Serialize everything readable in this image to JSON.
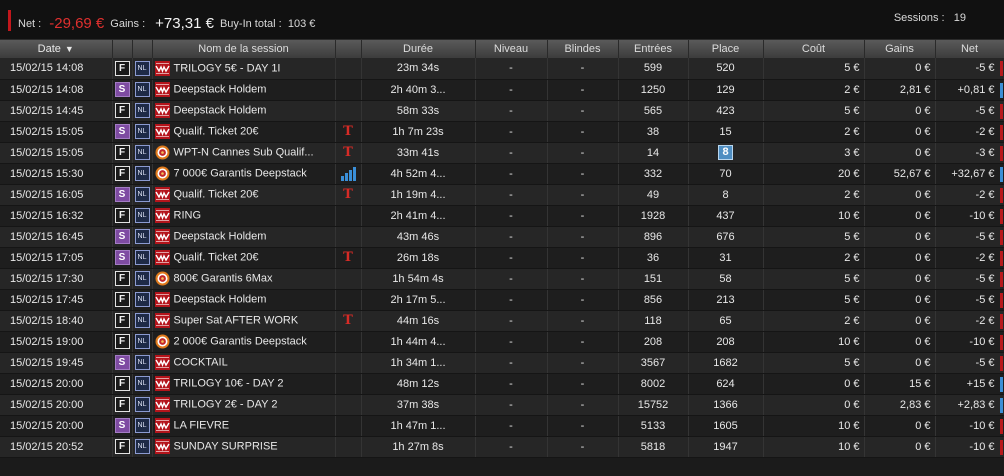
{
  "summary": {
    "net_label": "Net :",
    "net_value": "-29,69 €",
    "gains_label": "Gains :",
    "gains_value": "+73,31 €",
    "buyin_label": "Buy-In total :",
    "buyin_value": "103 €",
    "sessions_label": "Sessions :",
    "sessions_value": "19"
  },
  "columns": {
    "date": "Date",
    "name": "Nom de la session",
    "duree": "Durée",
    "niveau": "Niveau",
    "blindes": "Blindes",
    "entrees": "Entrées",
    "place": "Place",
    "cout": "Coût",
    "gains": "Gains",
    "net": "Net"
  },
  "colors": {
    "negative_flag": "#b8191c",
    "positive_flag": "#3d8fd6",
    "net_negative": "#e0302f"
  },
  "rows": [
    {
      "date": "15/02/15 14:08",
      "type": "F",
      "game": "NL",
      "room": "winamax",
      "name": "TRILOGY 5€ - DAY 1I",
      "marker": "",
      "duree": "23m 34s",
      "niveau": "-",
      "blindes": "-",
      "entrees": "599",
      "place": "520",
      "cout": "5 €",
      "gains": "0 €",
      "net": "-5 €",
      "result": "neg"
    },
    {
      "date": "15/02/15 14:08",
      "type": "S",
      "game": "NL",
      "room": "winamax",
      "name": "Deepstack Holdem",
      "marker": "",
      "duree": "2h 40m 3...",
      "niveau": "-",
      "blindes": "-",
      "entrees": "1250",
      "place": "129",
      "cout": "2 €",
      "gains": "2,81 €",
      "net": "+0,81 €",
      "result": "pos"
    },
    {
      "date": "15/02/15 14:45",
      "type": "F",
      "game": "NL",
      "room": "winamax",
      "name": "Deepstack Holdem",
      "marker": "",
      "duree": "58m 33s",
      "niveau": "-",
      "blindes": "-",
      "entrees": "565",
      "place": "423",
      "cout": "5 €",
      "gains": "0 €",
      "net": "-5 €",
      "result": "neg"
    },
    {
      "date": "15/02/15 15:05",
      "type": "S",
      "game": "NL",
      "room": "winamax",
      "name": "Qualif. Ticket 20€",
      "marker": "ticket",
      "duree": "1h 7m 23s",
      "niveau": "-",
      "blindes": "-",
      "entrees": "38",
      "place": "15",
      "cout": "2 €",
      "gains": "0 €",
      "net": "-2 €",
      "result": "neg"
    },
    {
      "date": "15/02/15 15:05",
      "type": "F",
      "game": "NL",
      "room": "chip",
      "name": "WPT-N Cannes Sub Qualif...",
      "marker": "ticket",
      "duree": "33m 41s",
      "niveau": "-",
      "blindes": "-",
      "entrees": "14",
      "place": "8",
      "place_highlight": true,
      "cout": "3 €",
      "gains": "0 €",
      "net": "-3 €",
      "result": "neg"
    },
    {
      "date": "15/02/15 15:30",
      "type": "F",
      "game": "NL",
      "room": "chip",
      "name": "7 000€ Garantis Deepstack",
      "marker": "chart",
      "duree": "4h 52m 4...",
      "niveau": "-",
      "blindes": "-",
      "entrees": "332",
      "place": "70",
      "cout": "20 €",
      "gains": "52,67 €",
      "net": "+32,67 €",
      "result": "pos"
    },
    {
      "date": "15/02/15 16:05",
      "type": "S",
      "game": "NL",
      "room": "winamax",
      "name": "Qualif. Ticket 20€",
      "marker": "ticket",
      "duree": "1h 19m 4...",
      "niveau": "-",
      "blindes": "-",
      "entrees": "49",
      "place": "8",
      "cout": "2 €",
      "gains": "0 €",
      "net": "-2 €",
      "result": "neg"
    },
    {
      "date": "15/02/15 16:32",
      "type": "F",
      "game": "NL",
      "room": "winamax",
      "name": "RING",
      "marker": "",
      "duree": "2h 41m 4...",
      "niveau": "-",
      "blindes": "-",
      "entrees": "1928",
      "place": "437",
      "cout": "10 €",
      "gains": "0 €",
      "net": "-10 €",
      "result": "neg"
    },
    {
      "date": "15/02/15 16:45",
      "type": "S",
      "game": "NL",
      "room": "winamax",
      "name": "Deepstack Holdem",
      "marker": "",
      "duree": "43m 46s",
      "niveau": "-",
      "blindes": "-",
      "entrees": "896",
      "place": "676",
      "cout": "5 €",
      "gains": "0 €",
      "net": "-5 €",
      "result": "neg"
    },
    {
      "date": "15/02/15 17:05",
      "type": "S",
      "game": "NL",
      "room": "winamax",
      "name": "Qualif. Ticket 20€",
      "marker": "ticket",
      "duree": "26m 18s",
      "niveau": "-",
      "blindes": "-",
      "entrees": "36",
      "place": "31",
      "cout": "2 €",
      "gains": "0 €",
      "net": "-2 €",
      "result": "neg"
    },
    {
      "date": "15/02/15 17:30",
      "type": "F",
      "game": "NL",
      "room": "chip",
      "name": "800€ Garantis 6Max",
      "marker": "",
      "duree": "1h 54m 4s",
      "niveau": "-",
      "blindes": "-",
      "entrees": "151",
      "place": "58",
      "cout": "5 €",
      "gains": "0 €",
      "net": "-5 €",
      "result": "neg"
    },
    {
      "date": "15/02/15 17:45",
      "type": "F",
      "game": "NL",
      "room": "winamax",
      "name": "Deepstack Holdem",
      "marker": "",
      "duree": "2h 17m 5...",
      "niveau": "-",
      "blindes": "-",
      "entrees": "856",
      "place": "213",
      "cout": "5 €",
      "gains": "0 €",
      "net": "-5 €",
      "result": "neg"
    },
    {
      "date": "15/02/15 18:40",
      "type": "F",
      "game": "NL",
      "room": "winamax",
      "name": "Super Sat AFTER WORK",
      "marker": "ticket",
      "duree": "44m 16s",
      "niveau": "-",
      "blindes": "-",
      "entrees": "118",
      "place": "65",
      "cout": "2 €",
      "gains": "0 €",
      "net": "-2 €",
      "result": "neg"
    },
    {
      "date": "15/02/15 19:00",
      "type": "F",
      "game": "NL",
      "room": "chip",
      "name": "2 000€ Garantis Deepstack",
      "marker": "",
      "duree": "1h 44m 4...",
      "niveau": "-",
      "blindes": "-",
      "entrees": "208",
      "place": "208",
      "cout": "10 €",
      "gains": "0 €",
      "net": "-10 €",
      "result": "neg"
    },
    {
      "date": "15/02/15 19:45",
      "type": "S",
      "game": "NL",
      "room": "winamax",
      "name": "COCKTAIL",
      "marker": "",
      "duree": "1h 34m 1...",
      "niveau": "-",
      "blindes": "-",
      "entrees": "3567",
      "place": "1682",
      "cout": "5 €",
      "gains": "0 €",
      "net": "-5 €",
      "result": "neg"
    },
    {
      "date": "15/02/15 20:00",
      "type": "F",
      "game": "NL",
      "room": "winamax",
      "name": "TRILOGY 10€ - DAY 2",
      "marker": "",
      "duree": "48m 12s",
      "niveau": "-",
      "blindes": "-",
      "entrees": "8002",
      "place": "624",
      "cout": "0 €",
      "gains": "15 €",
      "net": "+15 €",
      "result": "pos"
    },
    {
      "date": "15/02/15 20:00",
      "type": "F",
      "game": "NL",
      "room": "winamax",
      "name": "TRILOGY 2€ - DAY 2",
      "marker": "",
      "duree": "37m 38s",
      "niveau": "-",
      "blindes": "-",
      "entrees": "15752",
      "place": "1366",
      "cout": "0 €",
      "gains": "2,83 €",
      "net": "+2,83 €",
      "result": "pos"
    },
    {
      "date": "15/02/15 20:00",
      "type": "S",
      "game": "NL",
      "room": "winamax",
      "name": "LA FIEVRE",
      "marker": "",
      "duree": "1h 47m 1...",
      "niveau": "-",
      "blindes": "-",
      "entrees": "5133",
      "place": "1605",
      "cout": "10 €",
      "gains": "0 €",
      "net": "-10 €",
      "result": "neg"
    },
    {
      "date": "15/02/15 20:52",
      "type": "F",
      "game": "NL",
      "room": "winamax",
      "name": "SUNDAY SURPRISE",
      "marker": "",
      "duree": "1h 27m 8s",
      "niveau": "-",
      "blindes": "-",
      "entrees": "5818",
      "place": "1947",
      "cout": "10 €",
      "gains": "0 €",
      "net": "-10 €",
      "result": "neg"
    }
  ]
}
